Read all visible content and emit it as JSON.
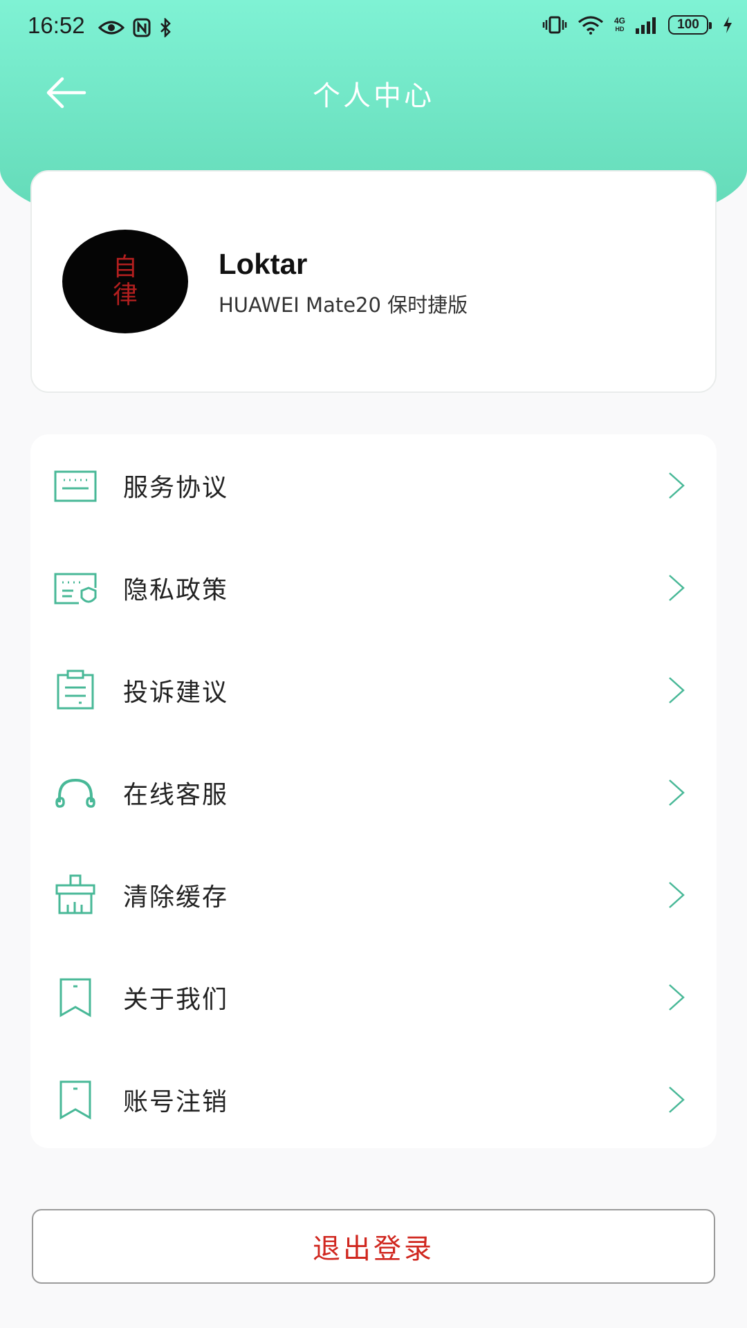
{
  "status_bar": {
    "time": "16:52",
    "network_label_top": "4G",
    "network_label_bottom": "HD",
    "battery": "100"
  },
  "nav": {
    "title": "个人中心",
    "back_icon": "arrow-left-icon"
  },
  "profile": {
    "avatar_text_1": "自",
    "avatar_text_2": "律",
    "name": "Loktar",
    "device": "HUAWEI Mate20 保时捷版"
  },
  "menu": {
    "items": [
      {
        "label": "服务协议",
        "icon": "keyboard-icon"
      },
      {
        "label": "隐私政策",
        "icon": "privacy-shield-icon"
      },
      {
        "label": "投诉建议",
        "icon": "clipboard-icon"
      },
      {
        "label": "在线客服",
        "icon": "headset-icon"
      },
      {
        "label": "清除缓存",
        "icon": "broom-icon"
      },
      {
        "label": "关于我们",
        "icon": "bookmark-icon"
      },
      {
        "label": "账号注销",
        "icon": "bookmark-icon"
      }
    ]
  },
  "logout": {
    "label": "退出登录"
  },
  "colors": {
    "accent": "#48b897",
    "header_top": "#7ff2d4",
    "header_bottom": "#5fd6b3",
    "logout_text": "#d0271f"
  }
}
